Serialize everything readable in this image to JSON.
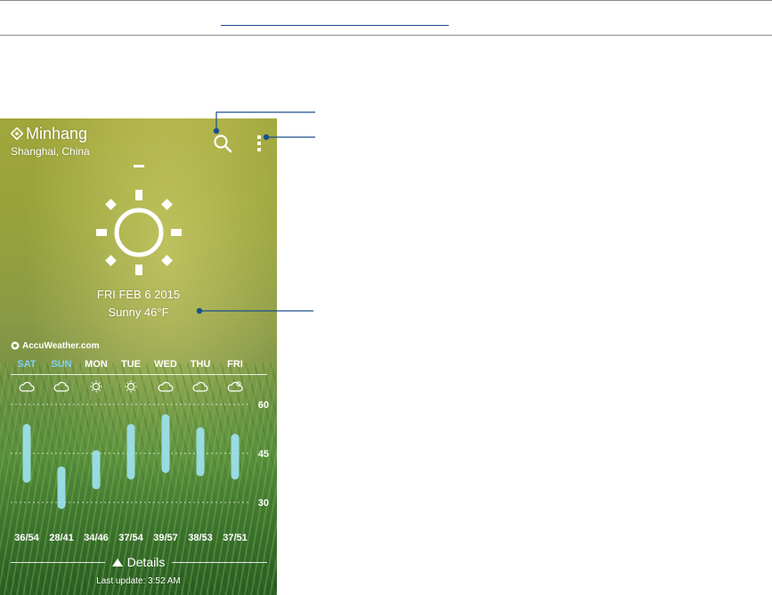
{
  "location": {
    "city": "Minhang",
    "region": "Shanghai, China"
  },
  "icons": {
    "location": "location-pin-icon",
    "search": "search-icon",
    "menu": "more-vert-icon",
    "sun": "sunny-icon"
  },
  "current": {
    "date": "FRI FEB 6 2015",
    "condition": "Sunny 46°F"
  },
  "provider": {
    "name": "AccuWeather.com"
  },
  "forecast": [
    {
      "day": "SAT",
      "icon": "cloud-icon",
      "temps": "36/54",
      "low": 36,
      "high": 54,
      "highlight": true
    },
    {
      "day": "SUN",
      "icon": "cloud-icon",
      "temps": "28/41",
      "low": 28,
      "high": 41,
      "highlight": true
    },
    {
      "day": "MON",
      "icon": "sun-icon",
      "temps": "34/46",
      "low": 34,
      "high": 46,
      "highlight": false
    },
    {
      "day": "TUE",
      "icon": "sun-icon",
      "temps": "37/54",
      "low": 37,
      "high": 54,
      "highlight": false
    },
    {
      "day": "WED",
      "icon": "cloud-icon",
      "temps": "39/57",
      "low": 39,
      "high": 57,
      "highlight": false
    },
    {
      "day": "THU",
      "icon": "cloud-icon",
      "temps": "38/53",
      "low": 38,
      "high": 53,
      "highlight": false
    },
    {
      "day": "FRI",
      "icon": "partly-cloudy-icon",
      "temps": "37/51",
      "low": 37,
      "high": 51,
      "highlight": false
    }
  ],
  "chart_axis": {
    "ticks": [
      "60",
      "45",
      "30"
    ],
    "tick_values": [
      60,
      45,
      30
    ]
  },
  "details_label": "Details",
  "last_update": "Last update: 3:52 AM",
  "colors": {
    "highlight_day": "#7fd3f2",
    "bar": "#9fe3f3",
    "callout": "#1a4f8c"
  }
}
